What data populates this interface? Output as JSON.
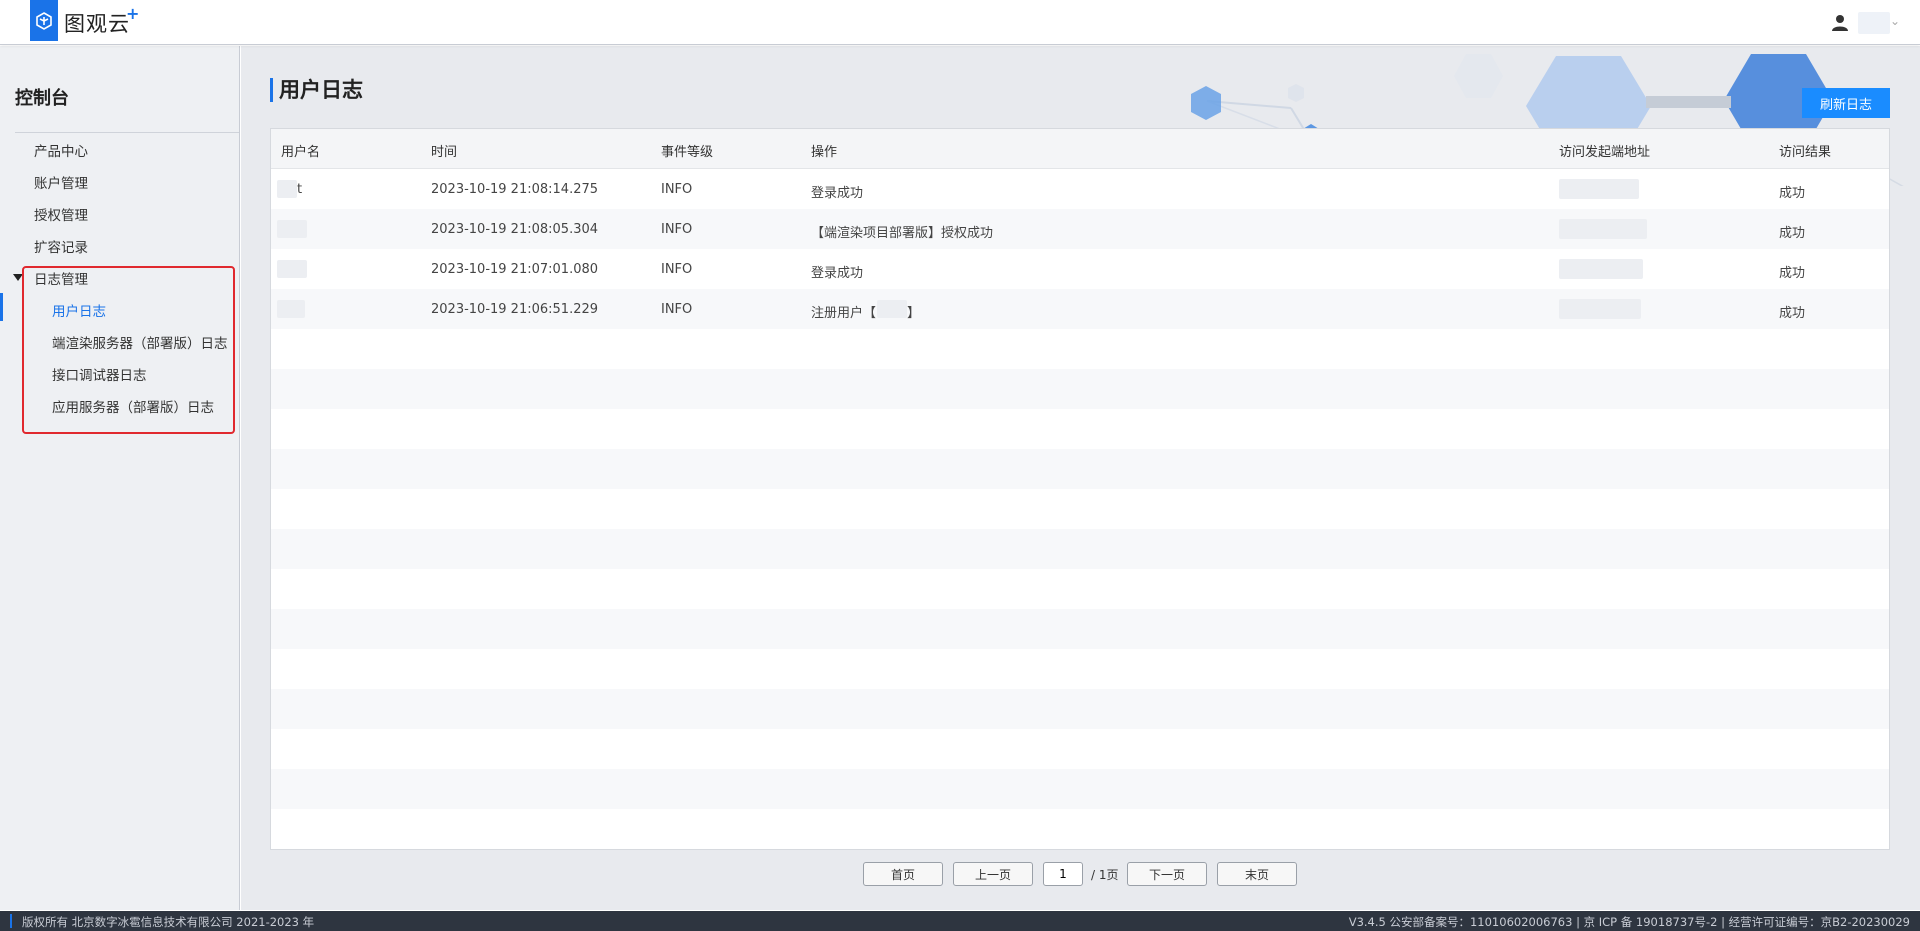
{
  "header": {
    "logo_text": "图观云",
    "logo_plus": "+"
  },
  "sidebar": {
    "title": "控制台",
    "items": [
      {
        "label": "产品中心"
      },
      {
        "label": "账户管理"
      },
      {
        "label": "授权管理"
      },
      {
        "label": "扩容记录"
      },
      {
        "label": "日志管理"
      }
    ],
    "log_children": [
      {
        "label": "用户日志"
      },
      {
        "label": "端渲染服务器（部署版）日志"
      },
      {
        "label": "接口调试器日志"
      },
      {
        "label": "应用服务器（部署版）日志"
      }
    ]
  },
  "main": {
    "title": "用户日志",
    "refresh_label": "刷新日志",
    "columns": [
      "用户名",
      "时间",
      "事件等级",
      "操作",
      "访问发起端地址",
      "访问结果"
    ],
    "rows": [
      {
        "user": "t",
        "time": "2023-10-19 21:08:14.275",
        "level": "INFO",
        "action": "登录成功",
        "result": "成功"
      },
      {
        "user": "",
        "time": "2023-10-19 21:08:05.304",
        "level": "INFO",
        "action": "【端渲染项目部署版】授权成功",
        "result": "成功"
      },
      {
        "user": "",
        "time": "2023-10-19 21:07:01.080",
        "level": "INFO",
        "action": "登录成功",
        "result": "成功"
      },
      {
        "user": "",
        "time": "2023-10-19 21:06:51.229",
        "level": "INFO",
        "action_prefix": "注册用户【",
        "action_suffix": "】",
        "result": "成功"
      }
    ]
  },
  "pagination": {
    "first": "首页",
    "prev": "上一页",
    "current": "1",
    "total": "/ 1页",
    "next": "下一页",
    "last": "末页"
  },
  "footer": {
    "copyright": "版权所有 北京数字冰雹信息技术有限公司 2021-2023 年",
    "info": "V3.4.5 公安部备案号：11010602006763 | 京 ICP 备 19018737号-2 | 经营许可证编号：京B2-20230029"
  },
  "colors": {
    "accent": "#1a73e8",
    "button": "#1a8cff",
    "highlight_box": "#e0282e"
  }
}
